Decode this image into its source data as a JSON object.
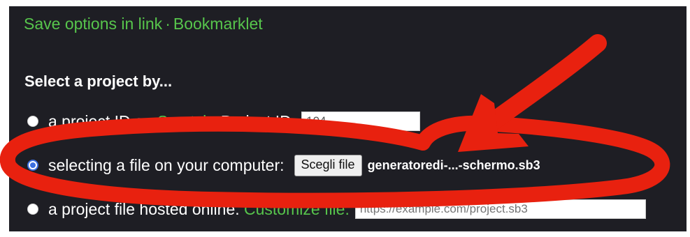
{
  "links": {
    "save_options": "Save options in link",
    "separator": "·",
    "bookmarklet": "Bookmarklet"
  },
  "section": {
    "heading": "Select a project by..."
  },
  "options": {
    "project_id": {
      "label_prefix": "a project ID on",
      "scratch_link": "Scratch",
      "label_suffix": ". Project ID:",
      "input_value": "104",
      "selected": false
    },
    "local_file": {
      "label": "selecting a file on your computer:",
      "button_label": "Scegli file",
      "file_name": "generatoredi-...-schermo.sb3",
      "selected": true
    },
    "hosted_file": {
      "label": "a project file hosted online.",
      "link_text": "Customize file.",
      "placeholder": "https://example.com/project.sb3",
      "selected": false
    }
  },
  "colors": {
    "background": "#1e1e24",
    "link_green": "#57c54c",
    "annotation_red": "#e8210f",
    "radio_blue": "#3b6fe0"
  }
}
